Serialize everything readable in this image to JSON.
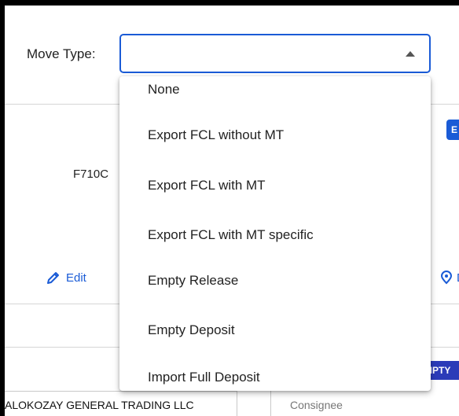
{
  "filter": {
    "label": "Move Type:",
    "selected_value": ""
  },
  "dropdown": {
    "options": [
      "None",
      "Export FCL without MT",
      "Export FCL with MT",
      "Export FCL with MT specific",
      "Empty Release",
      "Empty Deposit",
      "Import Full Deposit"
    ]
  },
  "background": {
    "booking_ref": "F710C",
    "edit_label": "Edit",
    "pin_label": "D",
    "badge_top": "E",
    "badge_bottom": "MPTY",
    "company": "ALOKOZAY GENERAL TRADING LLC",
    "consignee": "Consignee"
  },
  "colors": {
    "accent": "#1a5bd6",
    "badge_dark": "#2b3bb8"
  }
}
